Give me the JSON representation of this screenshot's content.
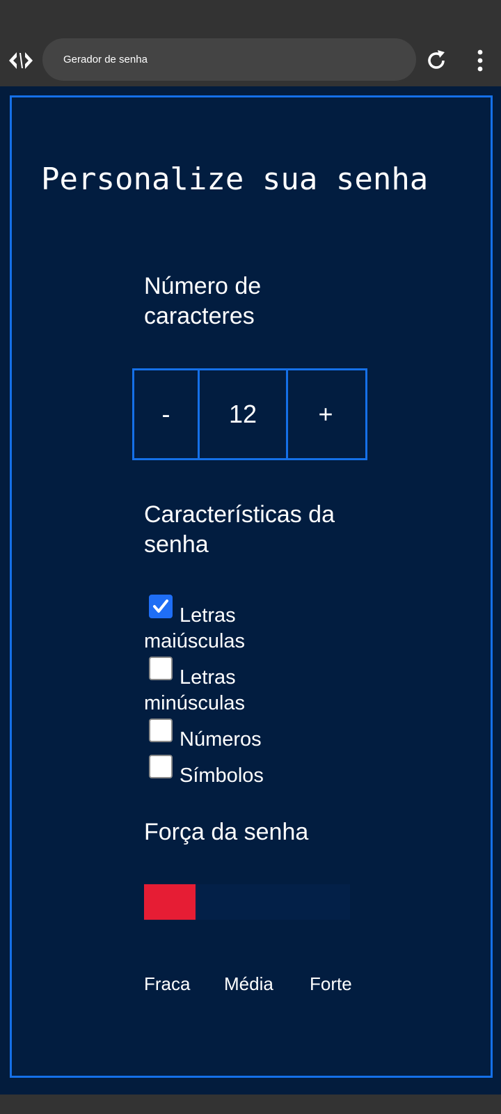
{
  "browser": {
    "tab_title": "Gerador de senha"
  },
  "page": {
    "title": "Personalize sua senha",
    "length_section": {
      "label": "Número de caracteres",
      "decrement_label": "-",
      "value": "12",
      "increment_label": "+"
    },
    "features_section": {
      "label": "Características da senha",
      "options": [
        {
          "label": "Letras maiúsculas",
          "checked": true
        },
        {
          "label": "Letras minúsculas",
          "checked": false
        },
        {
          "label": "Números",
          "checked": false
        },
        {
          "label": "Símbolos",
          "checked": false
        }
      ]
    },
    "strength_section": {
      "label": "Força da senha",
      "level_fraction": 0.25,
      "level_color": "#e61d34",
      "scale_labels": [
        "Fraca",
        "Média",
        "Forte"
      ]
    }
  },
  "colors": {
    "accent": "#1570e8",
    "page_background": "#021d40",
    "checkbox_checked": "#1f6ef5"
  },
  "icons": [
    "app-logo-icon",
    "reload-icon",
    "more-vert-icon",
    "checkmark-icon"
  ]
}
